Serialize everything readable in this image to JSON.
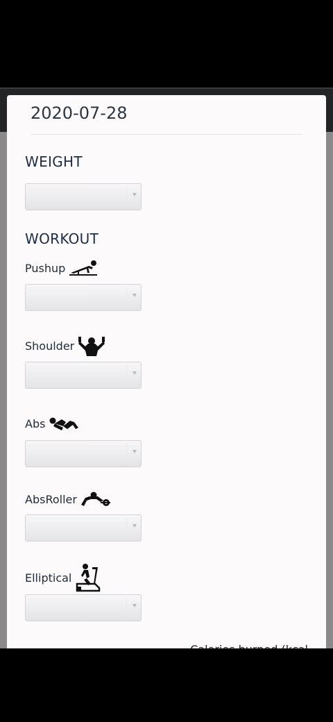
{
  "dialog": {
    "date": "2020-07-28",
    "weight_heading": "WEIGHT",
    "workout_heading": "WORKOUT",
    "footer_text": "Calories burned (kcal"
  },
  "exercises": [
    {
      "label": "Pushup",
      "icon": "pushup-icon"
    },
    {
      "label": "Shoulder",
      "icon": "shoulder-icon"
    },
    {
      "label": "Abs",
      "icon": "abs-icon"
    },
    {
      "label": "AbsRoller",
      "icon": "absroller-icon"
    },
    {
      "label": "Elliptical",
      "icon": "elliptical-icon"
    }
  ],
  "selects": {
    "weight": "",
    "pushup": "",
    "shoulder": "",
    "abs": "",
    "absroller": "",
    "elliptical": ""
  }
}
